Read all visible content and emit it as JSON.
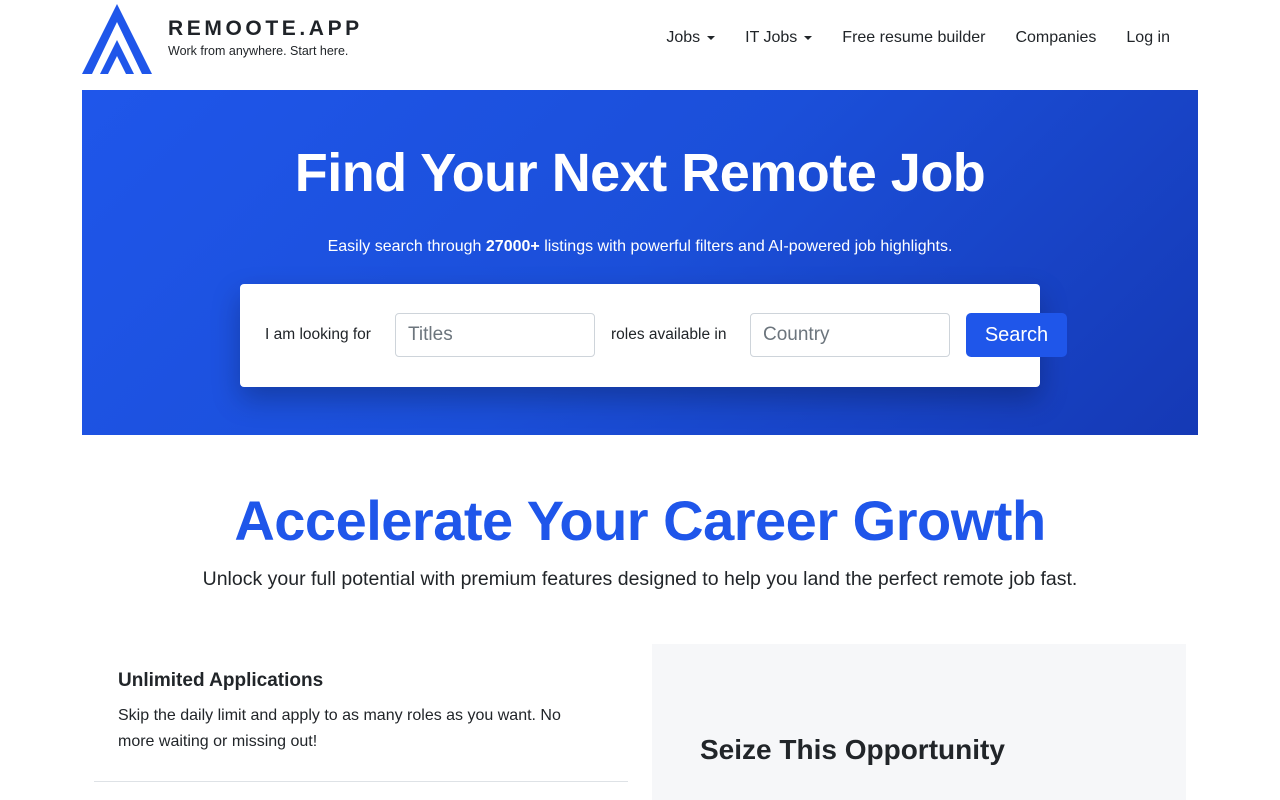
{
  "brand": {
    "name": "REMOOTE.APP",
    "tagline": "Work from anywhere. Start here.",
    "color": "#1f56ea"
  },
  "nav": {
    "items": [
      {
        "label": "Jobs",
        "dropdown": true
      },
      {
        "label": "IT Jobs",
        "dropdown": true
      },
      {
        "label": "Free resume builder",
        "dropdown": false
      },
      {
        "label": "Companies",
        "dropdown": false
      },
      {
        "label": "Log in",
        "dropdown": false
      }
    ]
  },
  "hero": {
    "title": "Find Your Next Remote Job",
    "subtitle_pre": "Easily search through ",
    "subtitle_count": "27000+",
    "subtitle_post": " listings with powerful filters and AI-powered job highlights.",
    "search": {
      "label_looking": "I am looking for",
      "title_placeholder": "Titles",
      "title_value": "",
      "label_roles": "roles available in",
      "country_placeholder": "Country",
      "country_value": "",
      "button_label": "Search"
    }
  },
  "career": {
    "title": "Accelerate Your Career Growth",
    "subtitle": "Unlock your full potential with premium features designed to help you land the perfect remote job fast."
  },
  "features": [
    {
      "title": "Unlimited Applications",
      "text": "Skip the daily limit and apply to as many roles as you want. No more waiting or missing out!"
    }
  ],
  "opportunity": {
    "title": "Seize This Opportunity"
  }
}
